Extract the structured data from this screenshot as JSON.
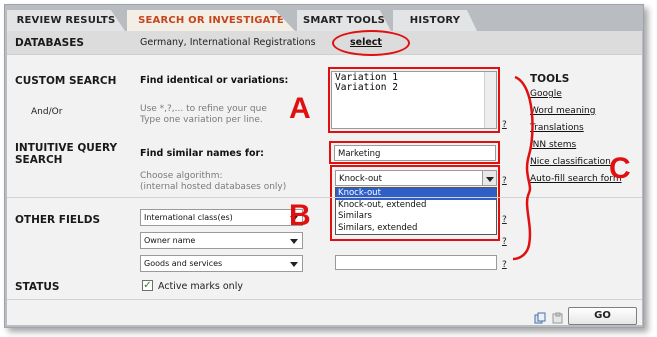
{
  "tabs": [
    "REVIEW RESULTS",
    "SEARCH OR INVESTIGATE",
    "SMART TOOLS",
    "HISTORY"
  ],
  "databases": {
    "label": "DATABASES",
    "value": "Germany, International Registrations",
    "select_link": "select"
  },
  "custom_search": {
    "label": "CUSTOM SEARCH",
    "sublabel": "And/Or",
    "field_label": "Find identical or variations:",
    "hint_line1": "Use *,?,... to refine your que",
    "hint_line2": "Type one variation per line.",
    "textarea_value": "Variation 1\nVariation 2",
    "help": "?"
  },
  "intuitive": {
    "label_line1": "INTUITIVE QUERY",
    "label_line2": "SEARCH",
    "field_label": "Find similar names for:",
    "input_value": "Marketing",
    "algo_label": "Choose algorithm:",
    "algo_sub": "(internal hosted databases only)",
    "algo_selected": "Knock-out",
    "algo_options": [
      "Knock-out",
      "Knock-out, extended",
      "Similars",
      "Similars, extended"
    ],
    "help": "?"
  },
  "other_fields": {
    "label": "OTHER FIELDS",
    "selects": [
      "International class(es)",
      "Owner name",
      "Goods and services"
    ],
    "help": "?"
  },
  "status": {
    "label": "STATUS",
    "checkbox_label": "Active marks only",
    "checked": true
  },
  "tools": {
    "title": "TOOLS",
    "items": [
      "Google",
      "Word meaning",
      "Translations",
      "INN stems",
      "Nice classification",
      "Auto-fill search form"
    ]
  },
  "annotations": {
    "a": "A",
    "b": "B",
    "c": "C"
  },
  "go_button": "GO",
  "accent_color": "#e01010",
  "active_tab_color": "#c4461e"
}
